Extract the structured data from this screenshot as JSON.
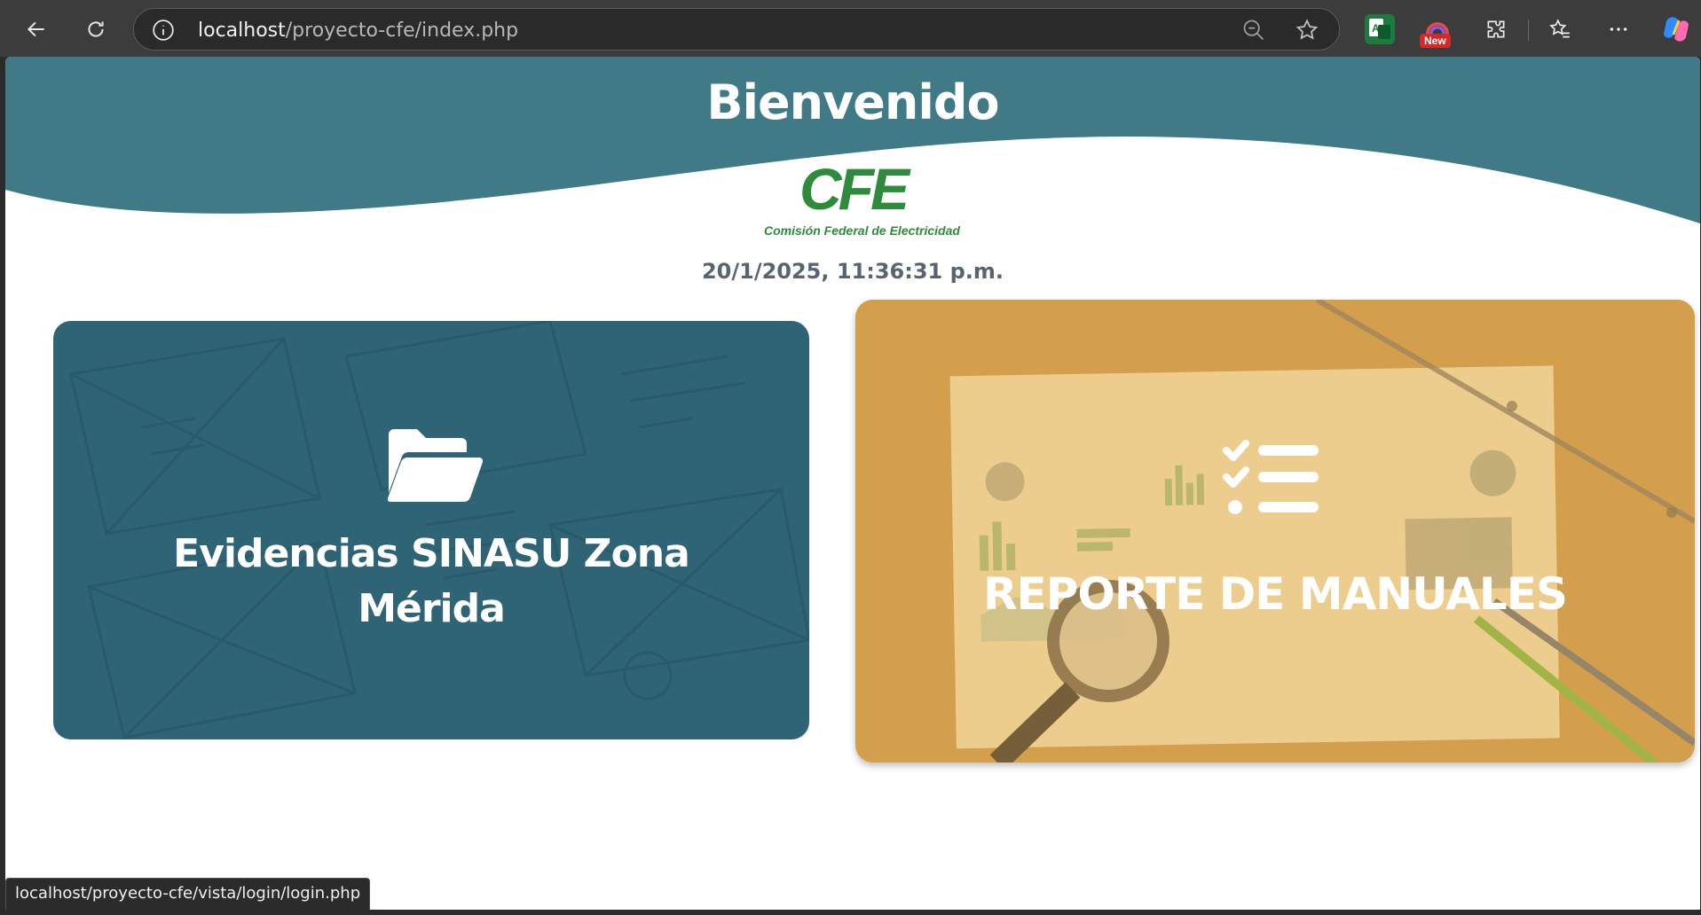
{
  "browser": {
    "url_host": "localhost",
    "url_path": "/proyecto-cfe/index.php",
    "extension_badge": "New",
    "status_url": "localhost/proyecto-cfe/vista/login/login.php"
  },
  "page": {
    "welcome": "Bienvenido",
    "logo_text": "CFE",
    "logo_subtitle": "Comisión Federal de Electricidad",
    "datetime": "20/1/2025, 11:36:31 p.m."
  },
  "cards": [
    {
      "title": "Evidencias SINASU Zona Mérida",
      "icon": "folder-open-icon",
      "color": "#2f6576"
    },
    {
      "title": "REPORTE DE MANUALES",
      "icon": "checklist-icon",
      "color": "#d9a852"
    }
  ],
  "colors": {
    "header_teal": "#3f7a86",
    "cfe_green": "#2e8b3c",
    "browser_chrome": "#3c3c3c"
  }
}
